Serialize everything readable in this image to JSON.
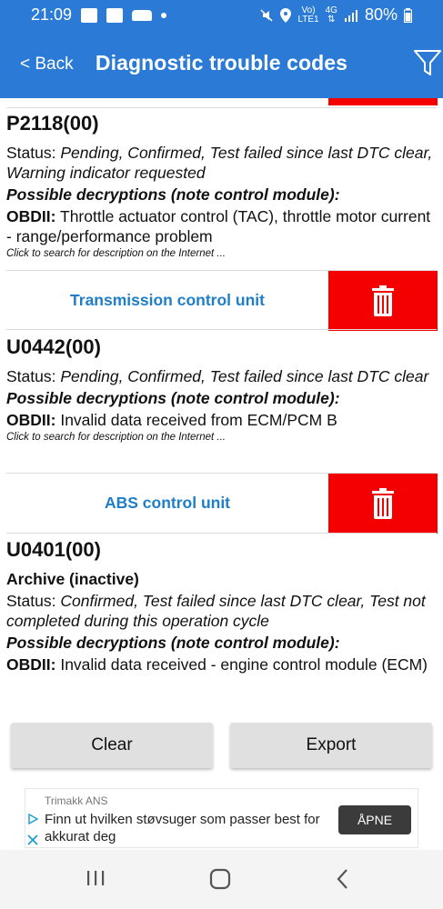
{
  "status_bar": {
    "time": "21:09",
    "network_top": "Vo)",
    "network_bottom": "LTE1",
    "net_type": "4G",
    "battery": "80%"
  },
  "app_bar": {
    "back_label": "< Back",
    "title": "Diagnostic trouble codes",
    "filter_icon": "filter-icon"
  },
  "dtcs": [
    {
      "code": "P2118(00)",
      "archive": "",
      "status_label": "Status:",
      "status_value": "Pending, Confirmed, Test failed since last DTC clear, Warning indicator requested",
      "possible_label": "Possible decryptions (note control module):",
      "obd_label": "OBDII:",
      "obd_text": "Throttle actuator control (TAC), throttle motor current - range/performance problem",
      "search_hint": "Click to search for description on the Internet ..."
    },
    {
      "code": "U0442(00)",
      "archive": "",
      "status_label": "Status:",
      "status_value": "Pending, Confirmed, Test failed since last DTC clear",
      "possible_label": "Possible decryptions (note control module):",
      "obd_label": "OBDII:",
      "obd_text": "Invalid data received from ECM/PCM B",
      "search_hint": "Click to search for description on the Internet ..."
    },
    {
      "code": "U0401(00)",
      "archive": "Archive (inactive)",
      "status_label": "Status:",
      "status_value": "Confirmed, Test failed since last DTC clear, Test not completed during this operation cycle",
      "possible_label": "Possible decryptions (note control module):",
      "obd_label": "OBDII:",
      "obd_text": "Invalid data received - engine control module (ECM)",
      "search_hint": ""
    }
  ],
  "control_units": [
    {
      "name": "Transmission control unit",
      "delete_icon": "trash-icon"
    },
    {
      "name": "ABS control unit",
      "delete_icon": "trash-icon"
    }
  ],
  "buttons": {
    "clear": "Clear",
    "export": "Export"
  },
  "ad": {
    "advertiser": "Trimakk ANS",
    "text": "Finn ut hvilken støvsuger som passer best for akkurat deg",
    "cta": "ÅPNE"
  },
  "colors": {
    "brand_blue": "#2b7bd6",
    "unit_link": "#1e7ec8",
    "delete_red": "#f40000"
  }
}
